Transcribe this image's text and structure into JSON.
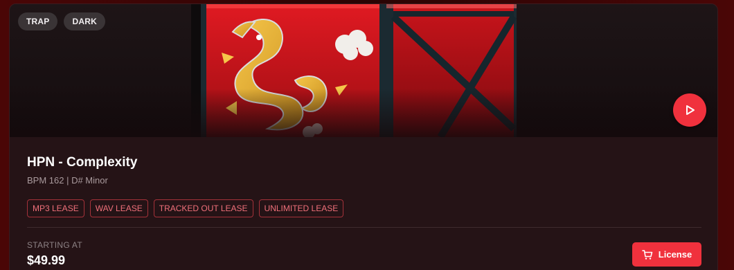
{
  "colors": {
    "accent": "#f0313d",
    "card_bg": "#251316",
    "tag_bg": "#3a3436",
    "license_border": "#a5323a",
    "license_text": "#f0707a"
  },
  "tags": [
    "TRAP",
    "DARK"
  ],
  "track": {
    "title": "HPN - Complexity",
    "meta": "BPM 162 | D# Minor"
  },
  "licenses": [
    "MP3 LEASE",
    "WAV LEASE",
    "TRACKED OUT LEASE",
    "UNLIMITED LEASE"
  ],
  "pricing": {
    "label": "STARTING AT",
    "price": "$49.99"
  },
  "actions": {
    "license_label": "License",
    "license_icon": "cart-icon",
    "play_icon": "play-icon"
  }
}
